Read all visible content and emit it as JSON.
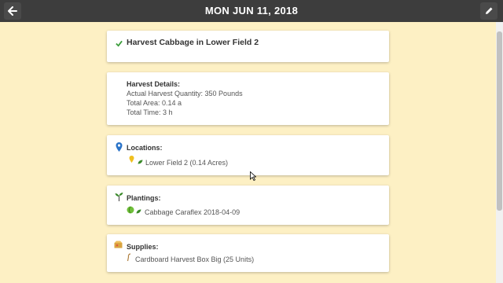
{
  "header": {
    "date": "MON JUN 11, 2018",
    "back_icon": "arrow-left-icon",
    "edit_icon": "pencil-icon"
  },
  "task": {
    "title": "Harvest Cabbage in Lower Field 2",
    "status_icon": "check-icon"
  },
  "harvest_details": {
    "heading": "Harvest Details:",
    "lines": [
      "Actual Harvest Quantity: 350 Pounds",
      "Total Area: 0.14 a",
      "Total Time: 3 h"
    ]
  },
  "locations": {
    "heading": "Locations:",
    "items": [
      "Lower Field 2 (0.14 Acres)"
    ]
  },
  "plantings": {
    "heading": "Plantings:",
    "items": [
      "Cabbage Caraflex 2018-04-09"
    ]
  },
  "supplies": {
    "heading": "Supplies:",
    "items": [
      "Cardboard Harvest Box Big (25 Units)"
    ]
  },
  "colors": {
    "background": "#fdf0c4",
    "topbar": "#3d3d3d",
    "check": "#3a9d3a",
    "pin": "#2a73c8",
    "leaf": "#3a8a2a"
  }
}
